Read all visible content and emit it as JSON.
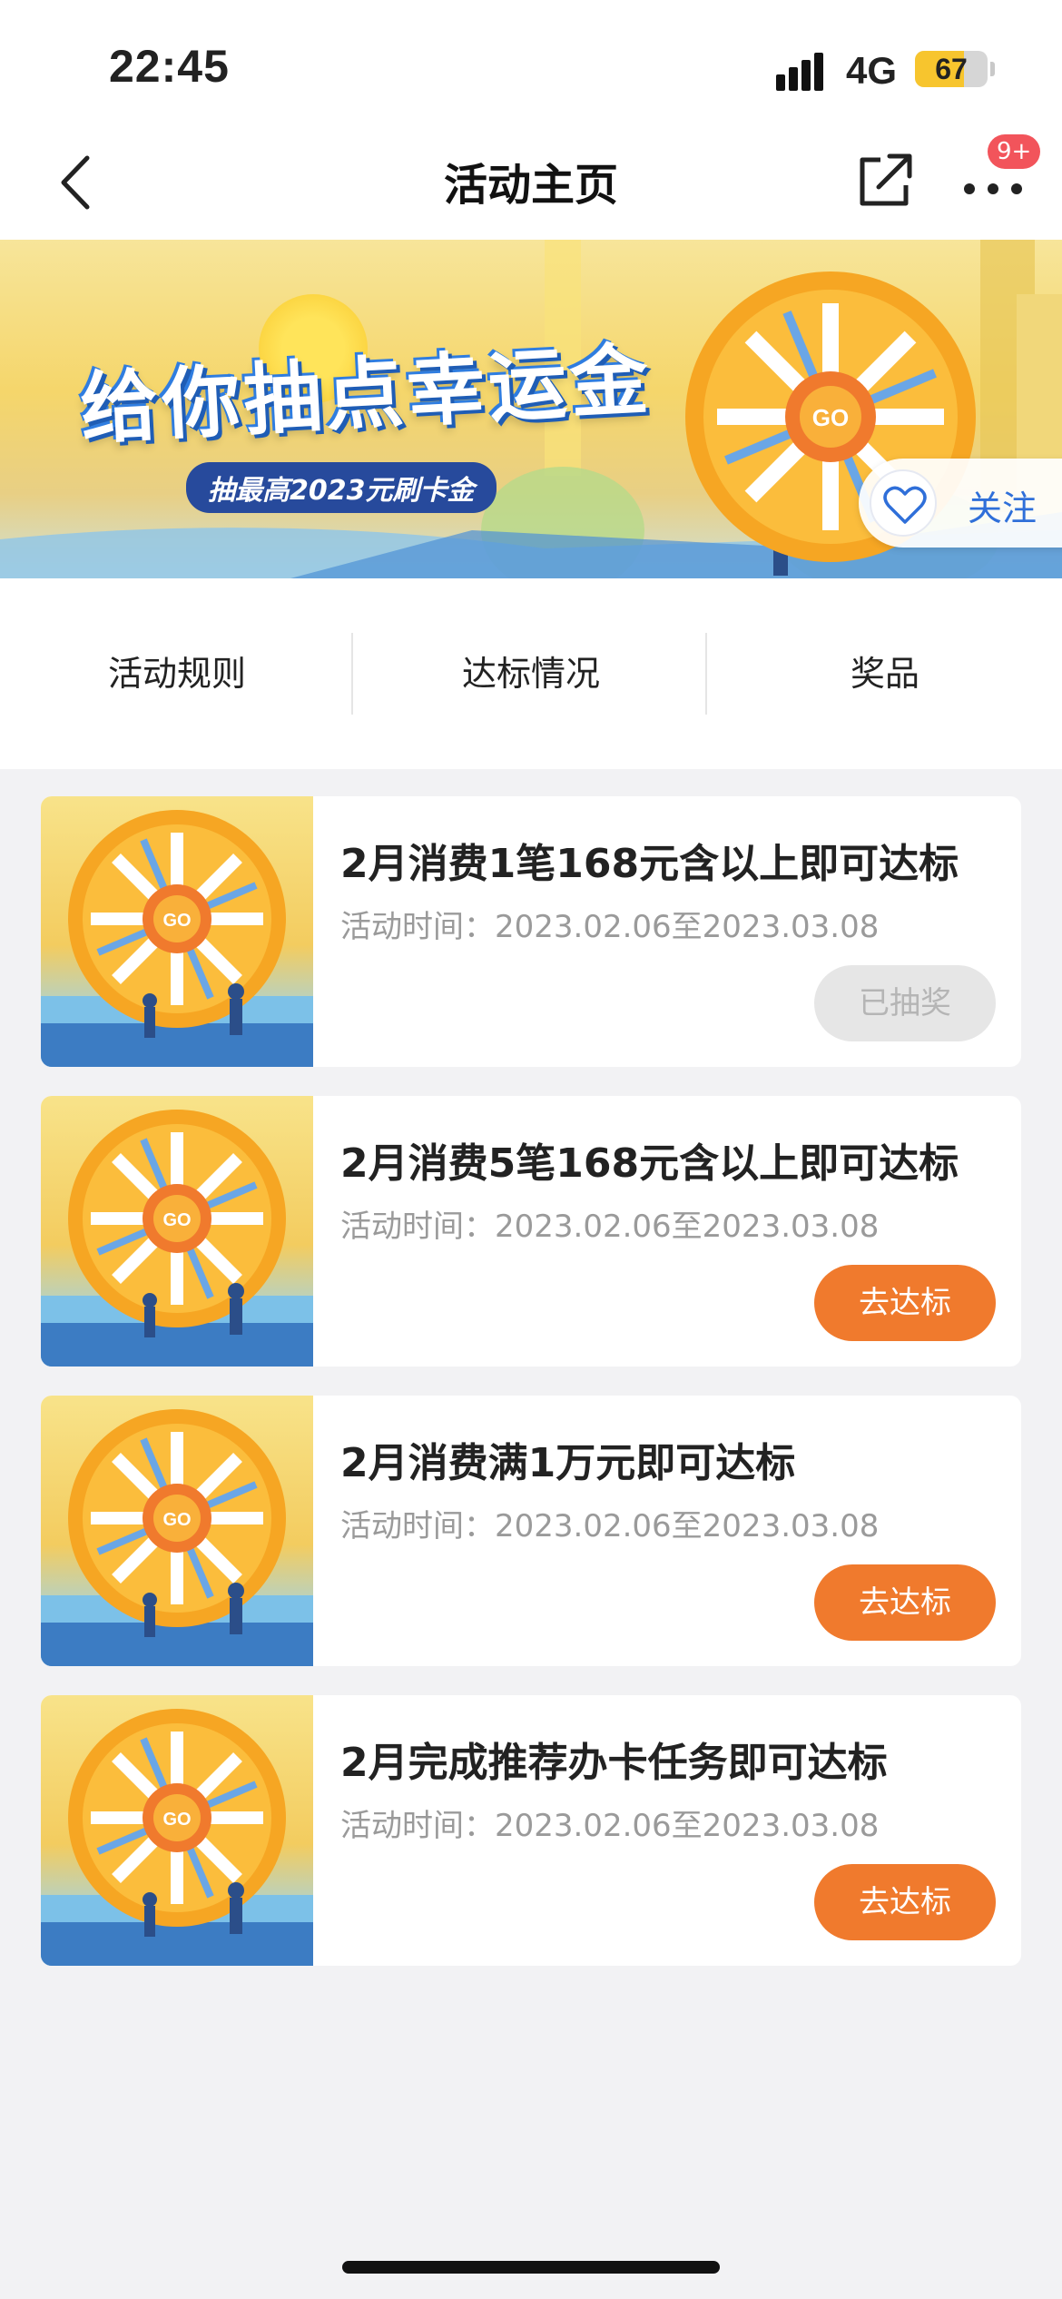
{
  "status_bar": {
    "time": "22:45",
    "network": "4G",
    "battery": "67",
    "battery_level": 0.67
  },
  "nav": {
    "title": "活动主页",
    "badge": "9+"
  },
  "banner": {
    "title": "给你抽点幸运金",
    "subtitle": "抽最高2023元刷卡金",
    "follow_label": "关注"
  },
  "tabs": [
    {
      "label": "活动规则"
    },
    {
      "label": "达标情况"
    },
    {
      "label": "奖品"
    }
  ],
  "cards": [
    {
      "title": "2月消费1笔168元含以上即可达标",
      "time": "活动时间：2023.02.06至2023.03.08",
      "button": "已抽奖",
      "enabled": false
    },
    {
      "title": "2月消费5笔168元含以上即可达标",
      "time": "活动时间：2023.02.06至2023.03.08",
      "button": "去达标",
      "enabled": true
    },
    {
      "title": "2月消费满1万元即可达标",
      "time": "活动时间：2023.02.06至2023.03.08",
      "button": "去达标",
      "enabled": true
    },
    {
      "title": "2月完成推荐办卡任务即可达标",
      "time": "活动时间：2023.02.06至2023.03.08",
      "button": "去达标",
      "enabled": true
    }
  ],
  "colors": {
    "accent": "#f07a2d",
    "link": "#2f6fd9",
    "badge": "#f2545b"
  },
  "icons": {
    "back": "chevron-left-icon",
    "share": "share-icon",
    "more": "more-dots-icon",
    "follow": "heart-icon"
  }
}
